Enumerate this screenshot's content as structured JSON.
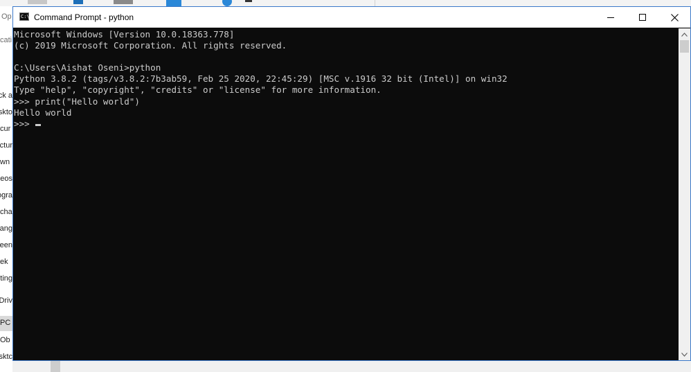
{
  "background_window": {
    "toolbar_text": "Op",
    "toolbar_subtext": "cati",
    "nav_items": [
      "ck a",
      "skto",
      "cur",
      "ctur",
      "wn",
      "leos",
      "ogra",
      "cha",
      "ang",
      "reen",
      "ek",
      "iting",
      "Driv",
      "PC",
      "Ob",
      "sktc"
    ]
  },
  "window": {
    "title": "Command Prompt - python",
    "icon_text": "C:\\",
    "controls": {
      "minimize": "Minimize",
      "maximize": "Maximize",
      "close": "Close"
    }
  },
  "terminal": {
    "lines": [
      "Microsoft Windows [Version 10.0.18363.778]",
      "(c) 2019 Microsoft Corporation. All rights reserved.",
      "",
      "C:\\Users\\Aishat Oseni>python",
      "Python 3.8.2 (tags/v3.8.2:7b3ab59, Feb 25 2020, 22:45:29) [MSC v.1916 32 bit (Intel)] on win32",
      "Type \"help\", \"copyright\", \"credits\" or \"license\" for more information.",
      ">>> print(\"Hello world\")",
      "Hello world"
    ],
    "prompt": ">>> "
  },
  "colors": {
    "console_bg": "#0c0c0c",
    "console_text": "#cccccc",
    "accent_border": "#3a78c9"
  }
}
